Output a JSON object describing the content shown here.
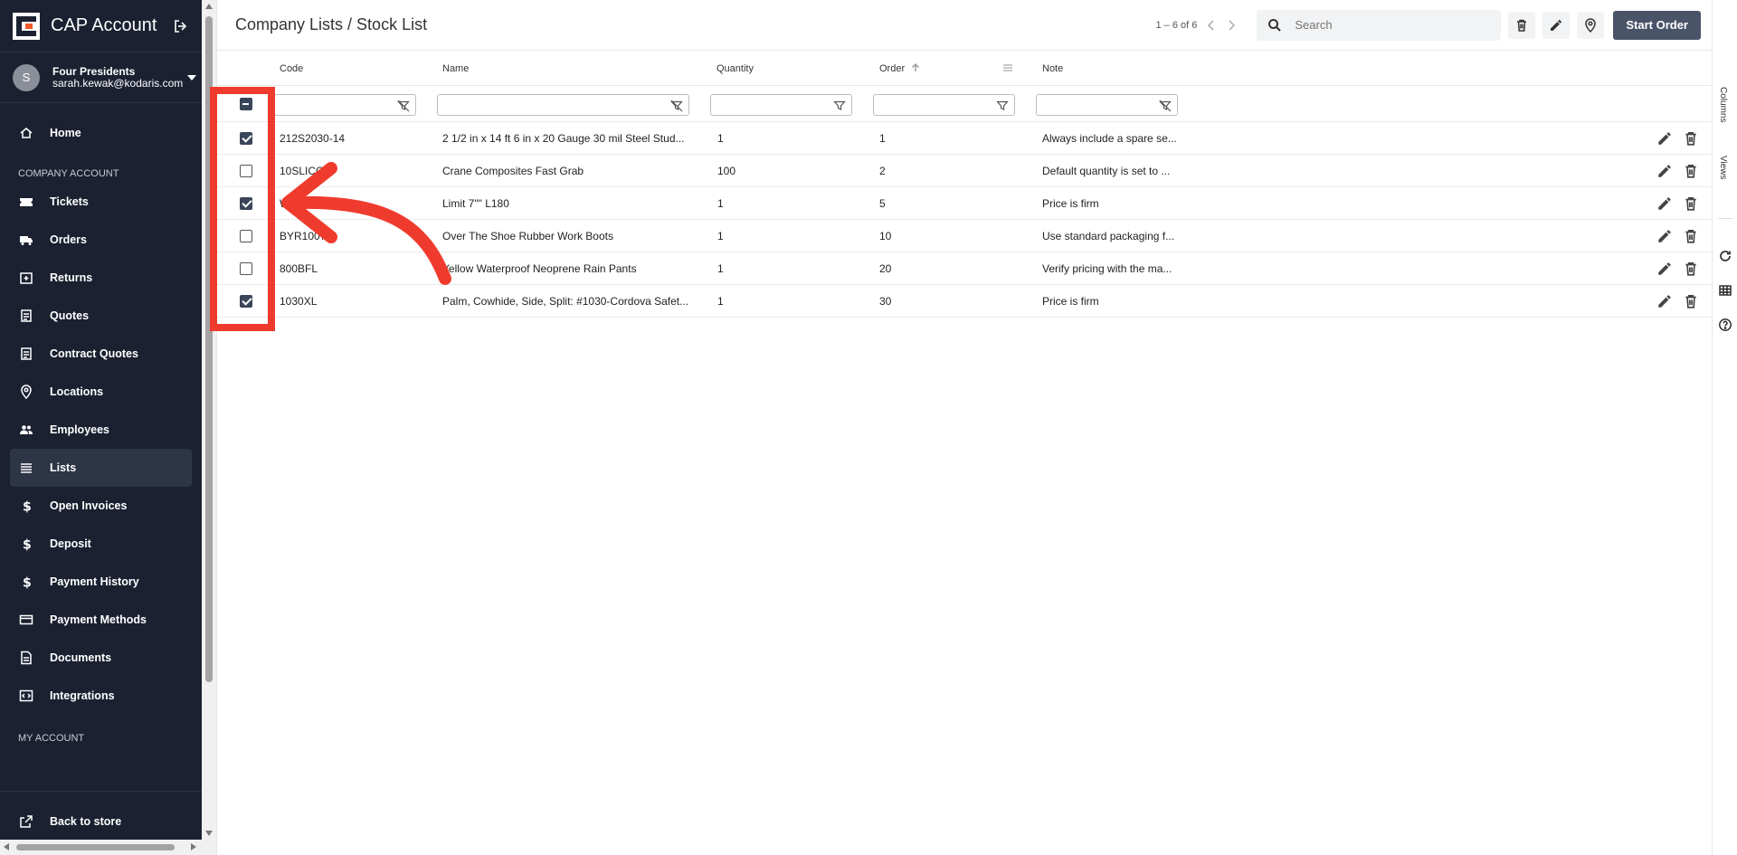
{
  "app": {
    "title": "CAP Account",
    "user_name": "Four Presidents",
    "user_email": "sarah.kewak@kodaris.com",
    "avatar_letter": "S",
    "accent": "#1b2131"
  },
  "sidebar": {
    "home": "Home",
    "section_company": "COMPANY ACCOUNT",
    "items": [
      {
        "label": "Tickets",
        "icon": "tickets-icon"
      },
      {
        "label": "Orders",
        "icon": "truck-icon"
      },
      {
        "label": "Returns",
        "icon": "returns-icon"
      },
      {
        "label": "Quotes",
        "icon": "clipboard-icon"
      },
      {
        "label": "Contract Quotes",
        "icon": "clipboard-icon"
      },
      {
        "label": "Locations",
        "icon": "location-pin-icon"
      },
      {
        "label": "Employees",
        "icon": "people-icon"
      },
      {
        "label": "Lists",
        "icon": "list-icon"
      },
      {
        "label": "Open Invoices",
        "icon": "dollar-icon"
      },
      {
        "label": "Deposit",
        "icon": "dollar-icon"
      },
      {
        "label": "Payment History",
        "icon": "dollar-icon"
      },
      {
        "label": "Payment Methods",
        "icon": "credit-card-icon"
      },
      {
        "label": "Documents",
        "icon": "document-icon"
      },
      {
        "label": "Integrations",
        "icon": "integrations-icon"
      }
    ],
    "section_my": "MY ACCOUNT",
    "back_to_store": "Back to store"
  },
  "header": {
    "breadcrumb": "Company Lists / Stock List",
    "pager": "1 – 6 of 6",
    "search_placeholder": "Search",
    "start_order": "Start Order"
  },
  "table": {
    "columns": {
      "code": "Code",
      "name": "Name",
      "quantity": "Quantity",
      "order": "Order",
      "note": "Note"
    },
    "rows": [
      {
        "checked": true,
        "code": "212S2030-14",
        "name": "2 1/2 in x 14 ft 6 in x 20 Gauge 30 mil Steel Stud...",
        "quantity": "1",
        "order": "1",
        "note": "Always include a spare se..."
      },
      {
        "checked": false,
        "code": "10SLICOS",
        "name": "Crane Composites Fast Grab",
        "quantity": "100",
        "order": "2",
        "note": "Default quantity is set to ..."
      },
      {
        "checked": true,
        "code": "WK",
        "name": "Limit 7\"\" L180",
        "quantity": "1",
        "order": "5",
        "note": "Price is firm"
      },
      {
        "checked": false,
        "code": "BYR1007",
        "name": "Over The Shoe Rubber Work Boots",
        "quantity": "1",
        "order": "10",
        "note": "Use standard packaging f..."
      },
      {
        "checked": false,
        "code": "800BFL",
        "name": "Yellow Waterproof Neoprene Rain Pants",
        "quantity": "1",
        "order": "20",
        "note": "Verify pricing with the ma..."
      },
      {
        "checked": true,
        "code": "1030XL",
        "name": "Palm, Cowhide, Side, Split: #1030-Cordova Safet...",
        "quantity": "1",
        "order": "30",
        "note": "Price is firm"
      }
    ]
  },
  "right_panel": {
    "columns_tab": "Columns",
    "views_tab": "Views"
  },
  "annotation": {
    "color": "#ef3b2d"
  }
}
